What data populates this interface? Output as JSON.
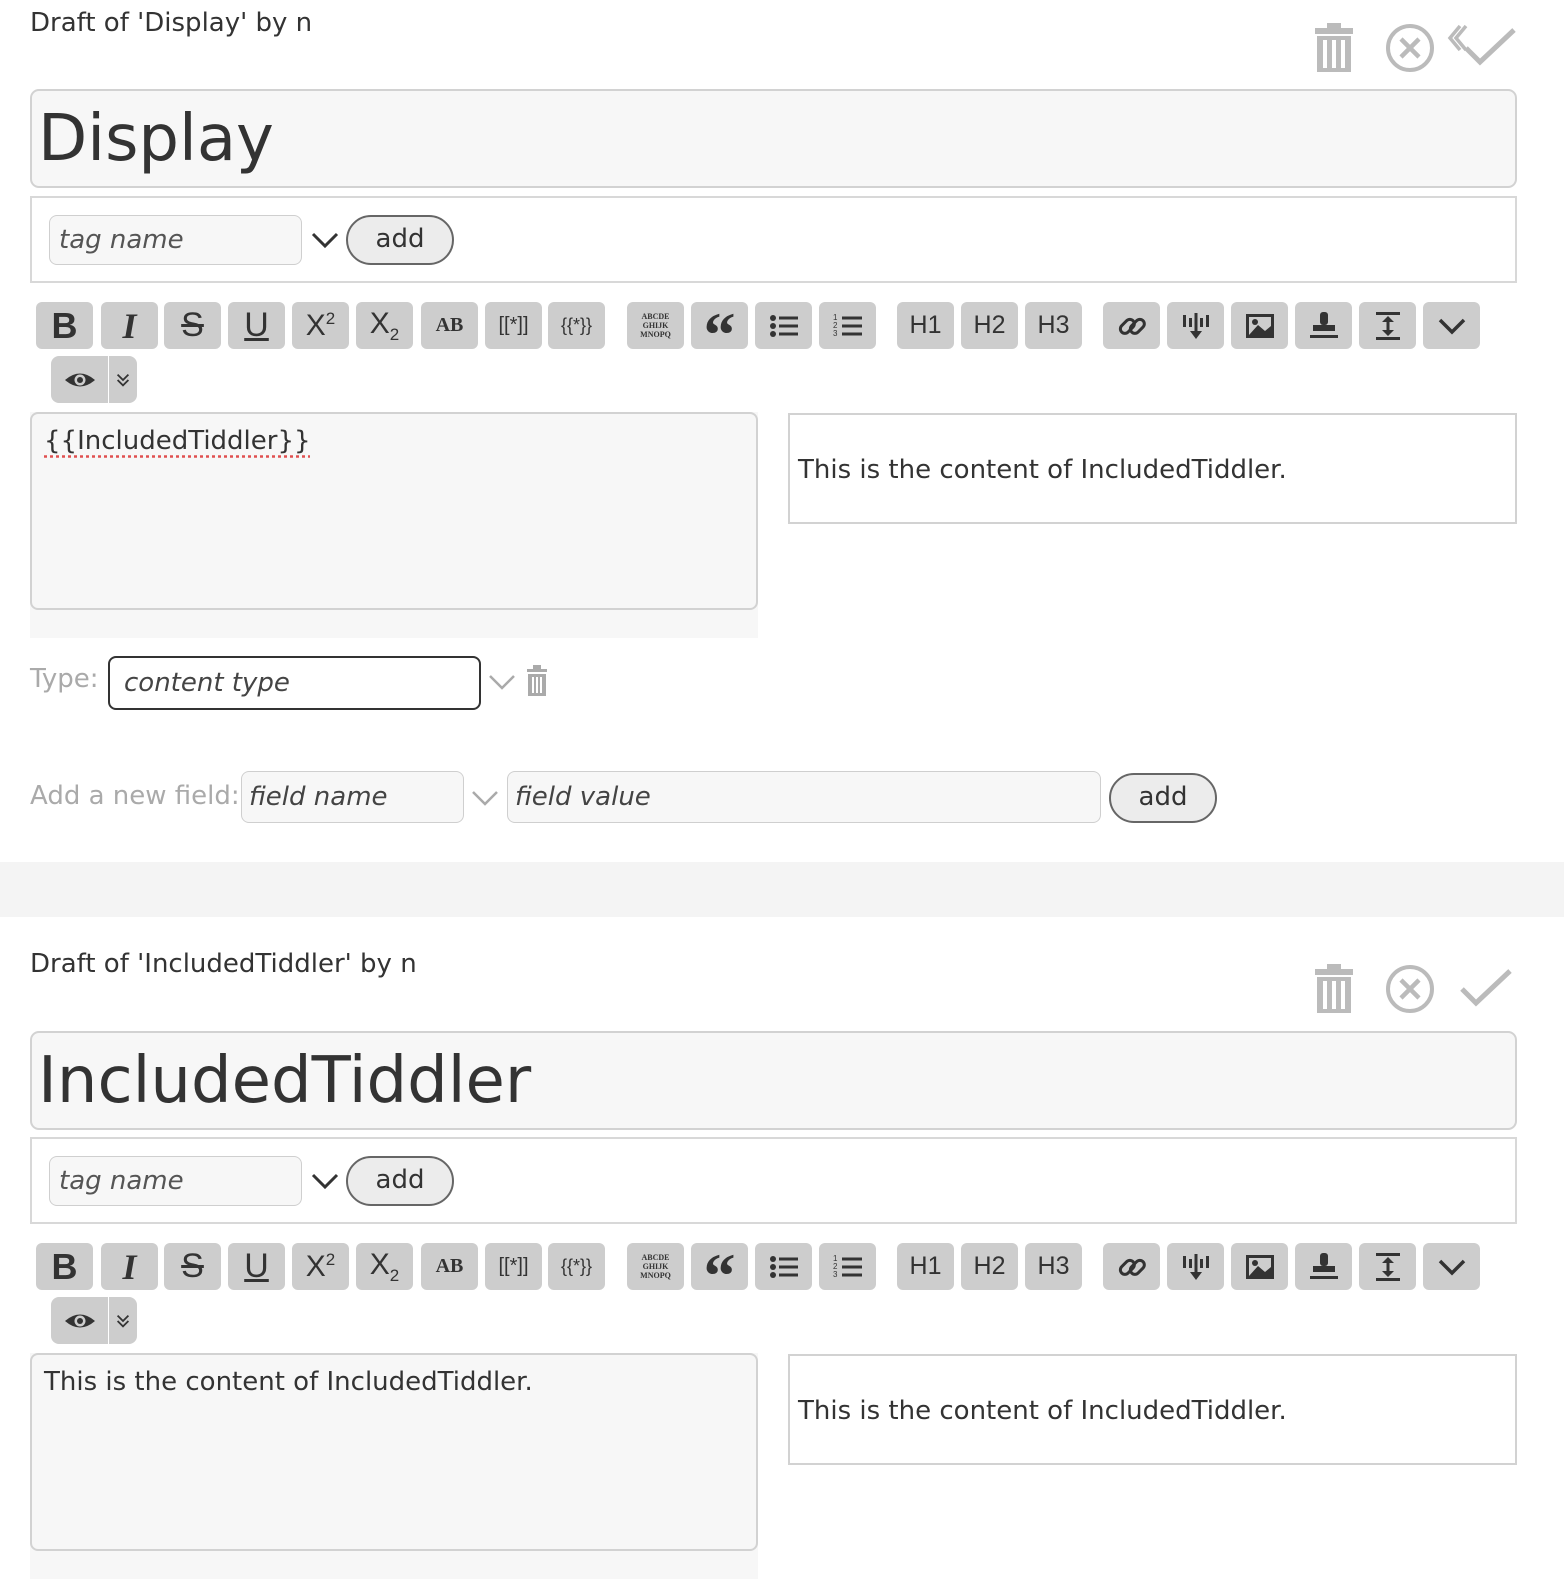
{
  "tiddlers": [
    {
      "subtitle": "Draft of 'Display' by n",
      "title": "Display",
      "tag_placeholder": "tag name",
      "tag_add_label": "add",
      "body_text": "{{IncludedTiddler}}",
      "preview_text": "This is the content of IncludedTiddler.",
      "type_label": "Type:",
      "type_placeholder": "content type",
      "field_label": "Add a new field:",
      "field_name_placeholder": "field name",
      "field_value_placeholder": "field value",
      "field_add_label": "add"
    },
    {
      "subtitle": "Draft of 'IncludedTiddler' by n",
      "title": "IncludedTiddler",
      "tag_placeholder": "tag name",
      "tag_add_label": "add",
      "body_text": "This is the content of IncludedTiddler.",
      "preview_text": "This is the content of IncludedTiddler."
    }
  ],
  "toolbar": {
    "buttons": [
      {
        "name": "bold",
        "label": "B"
      },
      {
        "name": "italic",
        "label": "I"
      },
      {
        "name": "strikethrough",
        "label": "S"
      },
      {
        "name": "underline",
        "label": "U"
      },
      {
        "name": "superscript",
        "label": "X2"
      },
      {
        "name": "subscript",
        "label": "X2"
      },
      {
        "name": "smallcaps",
        "label": "AB"
      },
      {
        "name": "wikilink",
        "label": "[[*]]"
      },
      {
        "name": "transclude",
        "label": "{{*}}"
      },
      {
        "name": "monospace-block",
        "label": "ABCDE GHIJK MNOPQ"
      },
      {
        "name": "quote",
        "label": "“"
      },
      {
        "name": "bullet-list",
        "label": ""
      },
      {
        "name": "numbered-list",
        "label": ""
      },
      {
        "name": "heading-1",
        "label": "H1"
      },
      {
        "name": "heading-2",
        "label": "H2"
      },
      {
        "name": "heading-3",
        "label": "H3"
      },
      {
        "name": "link",
        "label": ""
      },
      {
        "name": "excise",
        "label": ""
      },
      {
        "name": "picture",
        "label": ""
      },
      {
        "name": "stamp",
        "label": ""
      },
      {
        "name": "size",
        "label": ""
      },
      {
        "name": "more",
        "label": ""
      }
    ],
    "icons": {
      "delete": "trash-icon",
      "cancel": "cancel-circle-icon",
      "save": "checkmark-icon",
      "preview": "eye-icon",
      "preview_type": "double-chevron-down-icon"
    }
  }
}
